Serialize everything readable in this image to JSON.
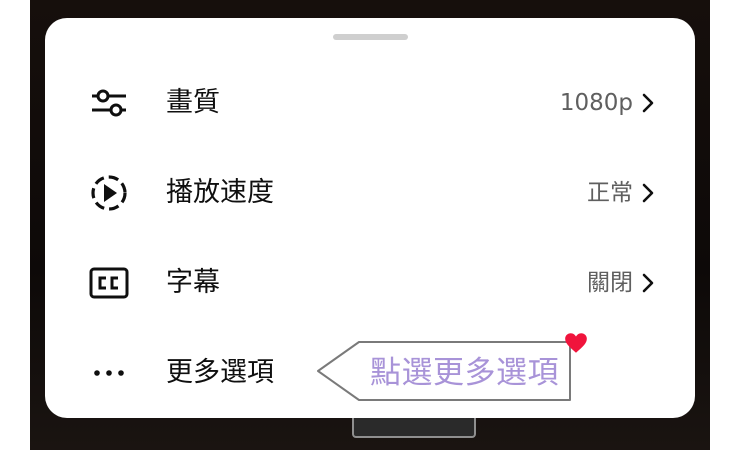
{
  "sheet": {
    "items": [
      {
        "label": "畫質",
        "value": "1080p",
        "icon": "sliders-icon"
      },
      {
        "label": "播放速度",
        "value": "正常",
        "icon": "playback-speed-icon"
      },
      {
        "label": "字幕",
        "value": "關閉",
        "icon": "cc-icon"
      },
      {
        "label": "更多選項",
        "value": "",
        "icon": "more-horizontal-icon"
      }
    ]
  },
  "callout": {
    "text": "點選更多選項"
  },
  "colors": {
    "callout_text": "#a893d8",
    "heart": "#f0143c",
    "sheet_bg": "#ffffff"
  }
}
